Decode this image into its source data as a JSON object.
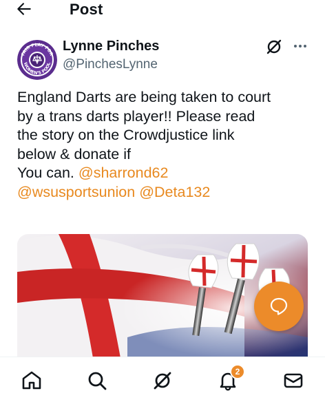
{
  "header": {
    "title": "Post"
  },
  "tweet": {
    "author_name": "Lynne Pinches",
    "author_handle": "@PinchesLynne",
    "avatar_text": {
      "top": "FAIR PLAY FOR",
      "bottom": "WOMEN'S POOL"
    },
    "text_lines": [
      "England Darts are being taken to court",
      "by a trans darts player!! Please read",
      "the story on the Crowdjustice link",
      "below & donate if"
    ],
    "last_line_prefix": "You can. ",
    "mentions": [
      "@sharrond62",
      "@wsusportsunion",
      "@Deta132"
    ],
    "media_alt": "England flag and darts"
  },
  "nav": {
    "items": [
      "home-icon",
      "search-icon",
      "grok-icon",
      "notifications-icon",
      "messages-icon"
    ],
    "notifications_badge": "2"
  },
  "colors": {
    "accent": "#ec8b2a",
    "mention": "#e8891f",
    "text": "#0f1419",
    "secondary": "#536471"
  }
}
